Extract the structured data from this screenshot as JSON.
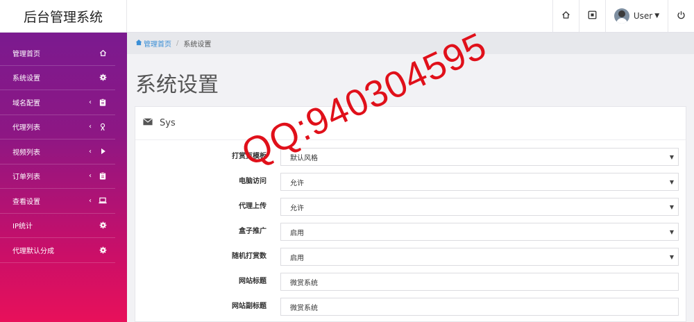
{
  "app": {
    "title": "后台管理系统"
  },
  "topbar": {
    "user_label": "User"
  },
  "sidebar": {
    "items": [
      {
        "label": "管理首页",
        "icon": "home-icon",
        "chevron": false
      },
      {
        "label": "系统设置",
        "icon": "gear-icon",
        "chevron": false
      },
      {
        "label": "域名配置",
        "icon": "clipboard-icon",
        "chevron": true
      },
      {
        "label": "代理列表",
        "icon": "user-icon",
        "chevron": true
      },
      {
        "label": "视频列表",
        "icon": "play-icon",
        "chevron": true
      },
      {
        "label": "订单列表",
        "icon": "clipboard-icon",
        "chevron": true
      },
      {
        "label": "查看设置",
        "icon": "laptop-icon",
        "chevron": true
      },
      {
        "label": "IP统计",
        "icon": "gear-icon",
        "chevron": false
      },
      {
        "label": "代理默认分成",
        "icon": "gear-icon",
        "chevron": false
      }
    ]
  },
  "breadcrumb": {
    "home": "管理首页",
    "current": "系统设置"
  },
  "page": {
    "title": "系统设置"
  },
  "panel": {
    "title": "Sys"
  },
  "form": {
    "rows": [
      {
        "label": "打赏页模板",
        "value": "默认风格",
        "type": "select"
      },
      {
        "label": "电脑访问",
        "value": "允许",
        "type": "select"
      },
      {
        "label": "代理上传",
        "value": "允许",
        "type": "select"
      },
      {
        "label": "盒子推广",
        "value": "启用",
        "type": "select"
      },
      {
        "label": "随机打赏数",
        "value": "启用",
        "type": "select"
      },
      {
        "label": "网站标题",
        "value": "微赏系统",
        "type": "input"
      },
      {
        "label": "网站副标题",
        "value": "微赏系统",
        "type": "input"
      }
    ]
  },
  "watermark": {
    "text": "QQ:940304595"
  },
  "colors": {
    "accent": "#3b8fd6",
    "sidebar_top": "#7b1a8f",
    "sidebar_bottom": "#e8105a",
    "watermark": "#e0101a"
  }
}
